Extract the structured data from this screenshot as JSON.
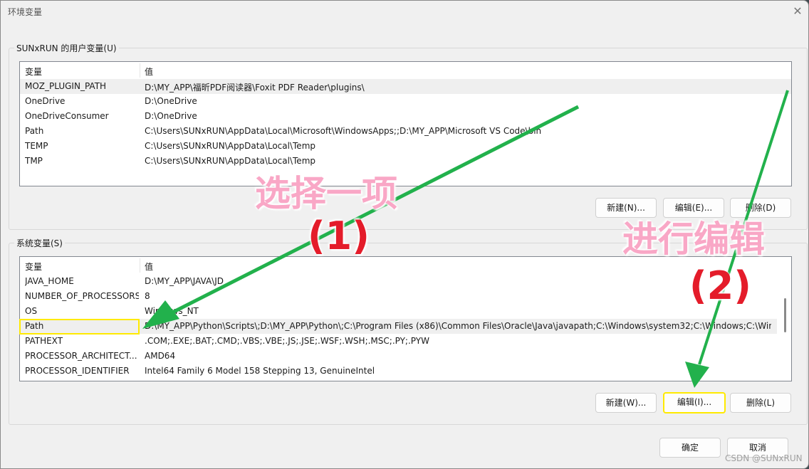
{
  "window": {
    "title": "环境变量",
    "close_icon": "✕"
  },
  "user_vars": {
    "label": "SUNxRUN 的用户变量(U)",
    "columns": [
      "变量",
      "值"
    ],
    "rows": [
      {
        "name": "MOZ_PLUGIN_PATH",
        "value": "D:\\MY_APP\\福昕PDF阅读器\\Foxit PDF Reader\\plugins\\"
      },
      {
        "name": "OneDrive",
        "value": "D:\\OneDrive"
      },
      {
        "name": "OneDriveConsumer",
        "value": "D:\\OneDrive"
      },
      {
        "name": "Path",
        "value": "C:\\Users\\SUNxRUN\\AppData\\Local\\Microsoft\\WindowsApps;;D:\\MY_APP\\Microsoft VS Code\\bin"
      },
      {
        "name": "TEMP",
        "value": "C:\\Users\\SUNxRUN\\AppData\\Local\\Temp"
      },
      {
        "name": "TMP",
        "value": "C:\\Users\\SUNxRUN\\AppData\\Local\\Temp"
      }
    ],
    "buttons": {
      "new": "新建(N)...",
      "edit": "编辑(E)...",
      "delete": "删除(D)"
    }
  },
  "system_vars": {
    "label": "系统变量(S)",
    "columns": [
      "变量",
      "值"
    ],
    "rows": [
      {
        "name": "JAVA_HOME",
        "value": "D:\\MY_APP\\JAVA\\JD"
      },
      {
        "name": "NUMBER_OF_PROCESSORS",
        "value": "8"
      },
      {
        "name": "OS",
        "value": "Windows_NT"
      },
      {
        "name": "Path",
        "value": "D:\\MY_APP\\Python\\Scripts\\;D:\\MY_APP\\Python\\;C:\\Program Files (x86)\\Common Files\\Oracle\\Java\\javapath;C:\\Windows\\system32;C:\\Windows;C:\\Wind..."
      },
      {
        "name": "PATHEXT",
        "value": ".COM;.EXE;.BAT;.CMD;.VBS;.VBE;.JS;.JSE;.WSF;.WSH;.MSC;.PY;.PYW"
      },
      {
        "name": "PROCESSOR_ARCHITECT...",
        "value": "AMD64"
      },
      {
        "name": "PROCESSOR_IDENTIFIER",
        "value": "Intel64 Family 6 Model 158 Stepping 13, GenuineIntel"
      }
    ],
    "selected_index": 3,
    "buttons": {
      "new": "新建(W)...",
      "edit": "编辑(I)...",
      "delete": "删除(L)"
    }
  },
  "footer": {
    "ok": "确定",
    "cancel": "取消"
  },
  "annotations": {
    "step1_text": "选择一项",
    "step1_num": "(1)",
    "step2_text": "进行编辑",
    "step2_num": "(2)",
    "arrow_color": "#22b14c",
    "highlight_color": "#ffea00"
  },
  "watermark": "CSDN @SUNxRUN"
}
